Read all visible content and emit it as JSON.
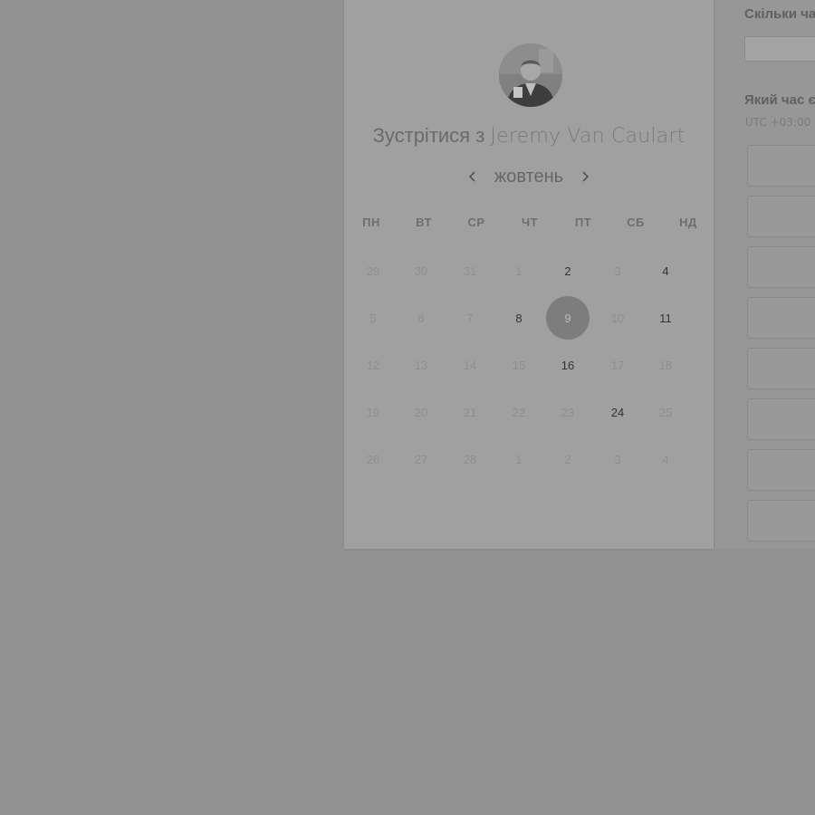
{
  "booking": {
    "title_prefix": "Зустрітися з",
    "host_name": "Jeremy Van Caulart",
    "avatar_icon": "person-photo",
    "month": "жовтень",
    "prev_icon": "chevron-left-icon",
    "next_icon": "chevron-right-icon",
    "weekdays": [
      "ПН",
      "ВТ",
      "СР",
      "ЧТ",
      "ПТ",
      "СБ",
      "НД"
    ],
    "weeks": [
      [
        {
          "label": "29",
          "state": "muted"
        },
        {
          "label": "30",
          "state": "muted"
        },
        {
          "label": "31",
          "state": "muted"
        },
        {
          "label": "1",
          "state": "muted"
        },
        {
          "label": "2",
          "state": "available"
        },
        {
          "label": "3",
          "state": "muted"
        },
        {
          "label": "4",
          "state": "available"
        }
      ],
      [
        {
          "label": "5",
          "state": "muted"
        },
        {
          "label": "6",
          "state": "muted"
        },
        {
          "label": "7",
          "state": "muted"
        },
        {
          "label": "8",
          "state": "available"
        },
        {
          "label": "9",
          "state": "selected"
        },
        {
          "label": "10",
          "state": "muted"
        },
        {
          "label": "11",
          "state": "available"
        }
      ],
      [
        {
          "label": "12",
          "state": "muted"
        },
        {
          "label": "13",
          "state": "muted"
        },
        {
          "label": "14",
          "state": "muted"
        },
        {
          "label": "15",
          "state": "muted"
        },
        {
          "label": "16",
          "state": "available"
        },
        {
          "label": "17",
          "state": "muted"
        },
        {
          "label": "18",
          "state": "muted"
        }
      ],
      [
        {
          "label": "19",
          "state": "muted"
        },
        {
          "label": "20",
          "state": "muted"
        },
        {
          "label": "21",
          "state": "muted"
        },
        {
          "label": "22",
          "state": "muted"
        },
        {
          "label": "23",
          "state": "muted"
        },
        {
          "label": "24",
          "state": "available"
        },
        {
          "label": "25",
          "state": "muted"
        }
      ],
      [
        {
          "label": "26",
          "state": "muted"
        },
        {
          "label": "27",
          "state": "muted"
        },
        {
          "label": "28",
          "state": "muted"
        },
        {
          "label": "1",
          "state": "muted"
        },
        {
          "label": "2",
          "state": "muted"
        },
        {
          "label": "3",
          "state": "muted"
        },
        {
          "label": "4",
          "state": "muted"
        }
      ]
    ]
  },
  "side": {
    "duration_label": "Скільки ча",
    "time_label": "Який час є",
    "timezone": "UTC +03:00"
  },
  "colors": {
    "overlay": "#929292",
    "selected_day": "#7d7d7d"
  }
}
